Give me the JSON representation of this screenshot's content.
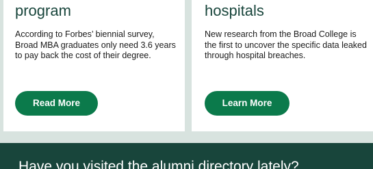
{
  "cards": [
    {
      "title": "program",
      "text": "According to Forbes’ biennial survey, Broad MBA graduates only need 3.6 years to pay back the cost of their degree.",
      "button_label": "Read More"
    },
    {
      "title": "hospitals",
      "text": "New research from the Broad College is the first to uncover the specific data leaked through hospital breaches.",
      "button_label": "Learn More"
    }
  ],
  "banner": {
    "text": "Have you visited the alumni directory lately?"
  },
  "colors": {
    "brand_green": "#18453b",
    "button_green": "#0b7a4b",
    "page_background": "#d8e3df"
  }
}
